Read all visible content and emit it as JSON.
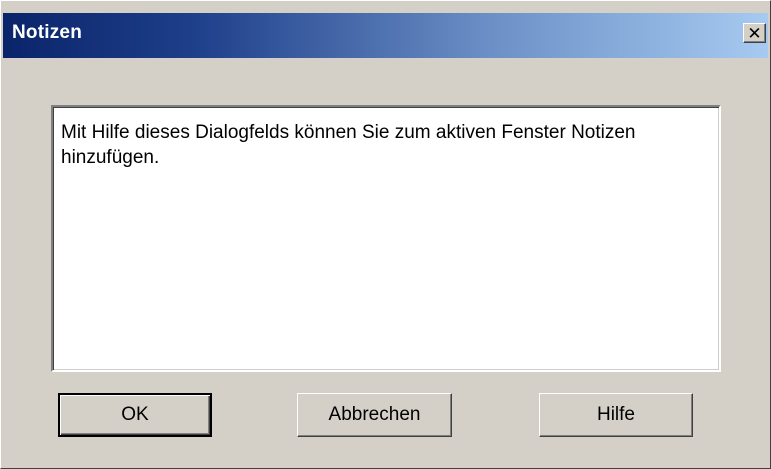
{
  "dialog": {
    "title": "Notizen",
    "close_symbol": "✕",
    "close_icon": "close-icon",
    "notes_text": "Mit Hilfe dieses Dialogfelds können Sie zum aktiven Fenster Notizen hinzufügen.",
    "buttons": {
      "ok": "OK",
      "cancel": "Abbrechen",
      "help": "Hilfe"
    },
    "colors": {
      "titlebar_start": "#0a246a",
      "titlebar_end": "#a6caf0",
      "face": "#d4d0c8"
    }
  }
}
